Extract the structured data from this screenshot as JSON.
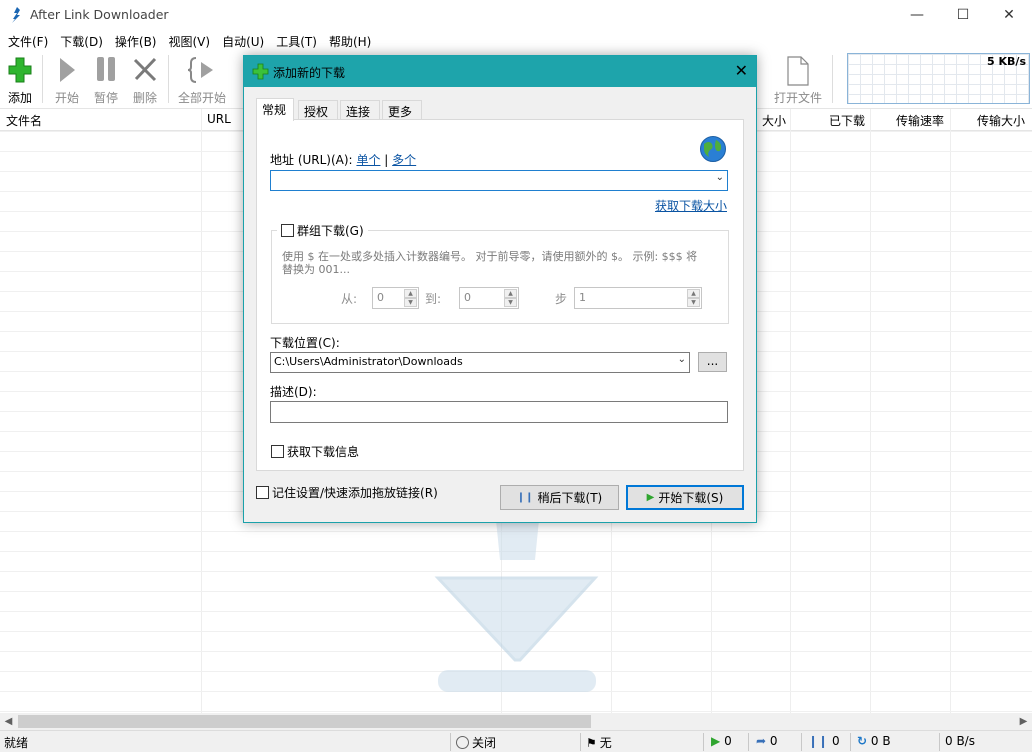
{
  "app": {
    "title": "After Link Downloader"
  },
  "menu": [
    "文件(F)",
    "下载(D)",
    "操作(B)",
    "视图(V)",
    "自动(U)",
    "工具(T)",
    "帮助(H)"
  ],
  "toolbar": {
    "add": "添加",
    "start": "开始",
    "pause": "暂停",
    "delete": "删除",
    "start_all": "全部开始",
    "open_file": "打开文件"
  },
  "speed_graph": {
    "label": "5 KB/s"
  },
  "columns": [
    "文件名",
    "URL",
    "大小",
    "已下载",
    "传输速率",
    "传输大小"
  ],
  "dialog": {
    "title": "添加新的下载",
    "tabs": [
      "常规",
      "授权",
      "连接",
      "更多"
    ],
    "url_label": "地址 (URL)(A):",
    "url_single": "单个",
    "url_sep": "|",
    "url_multiple": "多个",
    "url_value": "",
    "get_size": "获取下载大小",
    "group_download": "群组下载(G)",
    "group_hint": "使用 $ 在一处或多处插入计数器编号。 对于前导零，请使用额外的 $。 示例: $$$ 将替换为 001...",
    "from_label": "从:",
    "from_value": "0",
    "to_label": "到:",
    "to_value": "0",
    "step_label": "步",
    "step_value": "1",
    "location_label": "下载位置(C):",
    "location_value": "C:\\Users\\Administrator\\Downloads",
    "browse": "...",
    "desc_label": "描述(D):",
    "desc_value": "",
    "get_info": "获取下载信息",
    "remember": "记住设置/快速添加拖放链接(R)",
    "later_btn": "稍后下载(T)",
    "start_btn": "开始下载(S)"
  },
  "status": {
    "ready": "就绪",
    "schedule": "关闭",
    "limit": "无",
    "active": "0",
    "queued": "0",
    "paused": "0",
    "downloaded": "0 B",
    "speed": "0 B/s"
  }
}
